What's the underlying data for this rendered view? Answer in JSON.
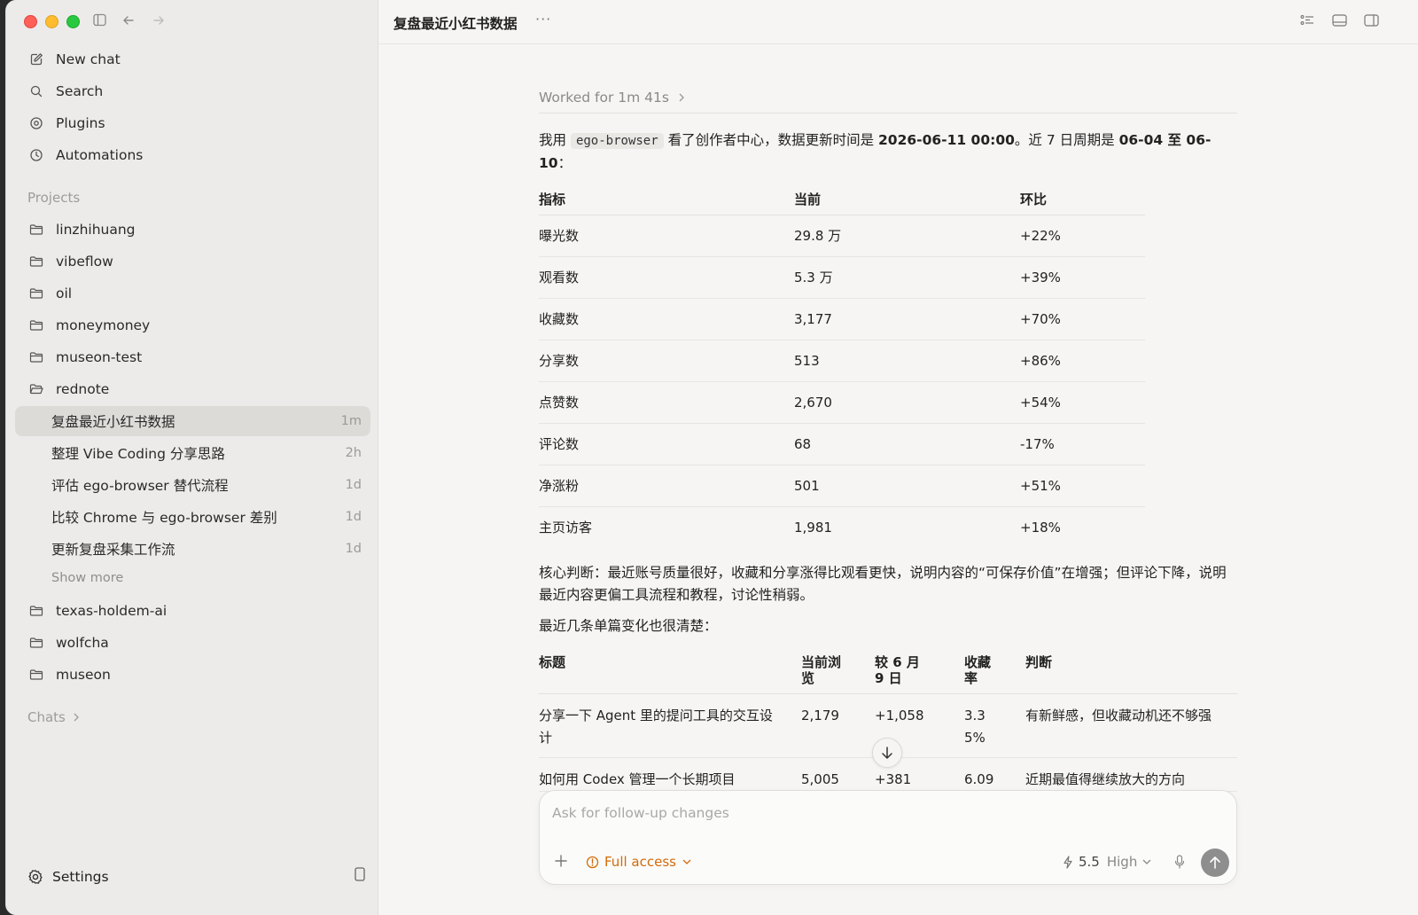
{
  "sidebar": {
    "nav": [
      {
        "label": "New chat",
        "icon": "compose-icon"
      },
      {
        "label": "Search",
        "icon": "search-icon"
      },
      {
        "label": "Plugins",
        "icon": "plugin-icon"
      },
      {
        "label": "Automations",
        "icon": "clock-icon"
      }
    ],
    "projects_label": "Projects",
    "projects_top": [
      "linzhihuang",
      "vibeflow",
      "oil",
      "moneymoney",
      "museon-test",
      "rednote"
    ],
    "threads": [
      {
        "label": "复盘最近小红书数据",
        "time": "1m",
        "active": true
      },
      {
        "label": "整理 Vibe Coding 分享思路",
        "time": "2h"
      },
      {
        "label": "评估 ego-browser 替代流程",
        "time": "1d"
      },
      {
        "label": "比较 Chrome 与 ego-browser 差别",
        "time": "1d"
      },
      {
        "label": "更新复盘采集工作流",
        "time": "1d"
      }
    ],
    "show_more": "Show more",
    "projects_bottom": [
      "texas-holdem-ai",
      "wolfcha",
      "museon"
    ],
    "chats_label": "Chats",
    "settings_label": "Settings"
  },
  "topbar": {
    "title": "复盘最近小红书数据",
    "more": "···"
  },
  "message": {
    "worked": "Worked for 1m 41s",
    "intro": {
      "p1": "我用 ",
      "code": "ego-browser",
      "p2": " 看了创作者中心，数据更新时间是 ",
      "b1": "2026-06-11 00:00",
      "p3": "。近 7 日周期是 ",
      "b2": "06-04 至 06-10",
      "p4": "："
    },
    "table1": {
      "headers": [
        "指标",
        "当前",
        "环比"
      ],
      "rows": [
        [
          "曝光数",
          "29.8 万",
          "+22%"
        ],
        [
          "观看数",
          "5.3 万",
          "+39%"
        ],
        [
          "收藏数",
          "3,177",
          "+70%"
        ],
        [
          "分享数",
          "513",
          "+86%"
        ],
        [
          "点赞数",
          "2,670",
          "+54%"
        ],
        [
          "评论数",
          "68",
          "-17%"
        ],
        [
          "净涨粉",
          "501",
          "+51%"
        ],
        [
          "主页访客",
          "1,981",
          "+18%"
        ]
      ]
    },
    "judgment_label": "核心判断：",
    "judgment": "最近账号质量很好，收藏和分享涨得比观看更快，说明内容的“可保存价值”在增强；但评论下降，说明最近内容更偏工具流程和教程，讨论性稍弱。",
    "recent_intro": "最近几条单篇变化也很清楚：",
    "table2": {
      "headers": [
        "标题",
        "当前浏览",
        "较 6 月 9 日",
        "收藏率",
        "判断"
      ],
      "rows": [
        [
          "分享一下 Agent 里的提问工具的交互设计",
          "2,179",
          "+1,058",
          "3.35%",
          "有新鲜感，但收藏动机还不够强"
        ],
        [
          "如何用 Codex 管理一个长期项目",
          "5,005",
          "+381",
          "6.09",
          "近期最值得继续放大的方向"
        ]
      ]
    }
  },
  "composer": {
    "placeholder": "Ask for follow-up changes",
    "access": "Full access",
    "model": "5.5",
    "effort": "High"
  },
  "colors": {
    "accent_access": "#d46b08",
    "active_row": "#dcdbd8"
  }
}
